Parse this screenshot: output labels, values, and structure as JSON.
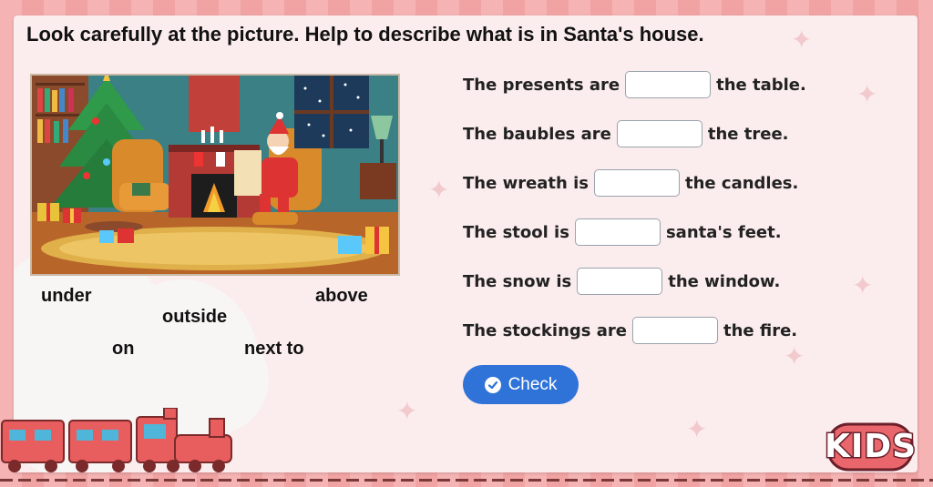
{
  "title": "Look carefully at the picture. Help to describe what is in Santa's house.",
  "word_bank": [
    "under",
    "above",
    "outside",
    "on",
    "next to"
  ],
  "sentences": [
    {
      "before": "The presents are",
      "after": "the table."
    },
    {
      "before": "The baubles are",
      "after": "the tree."
    },
    {
      "before": "The wreath is",
      "after": "the candles."
    },
    {
      "before": "The stool is",
      "after": "santa's feet."
    },
    {
      "before": "The snow is",
      "after": "the window."
    },
    {
      "before": "The stockings are",
      "after": "the fire."
    }
  ],
  "check_button": {
    "label": "Check"
  },
  "logo": {
    "text": "KIDS"
  },
  "colors": {
    "accent": "#2f73d9",
    "background": "#f3a9a9",
    "card": "#fbeced"
  }
}
